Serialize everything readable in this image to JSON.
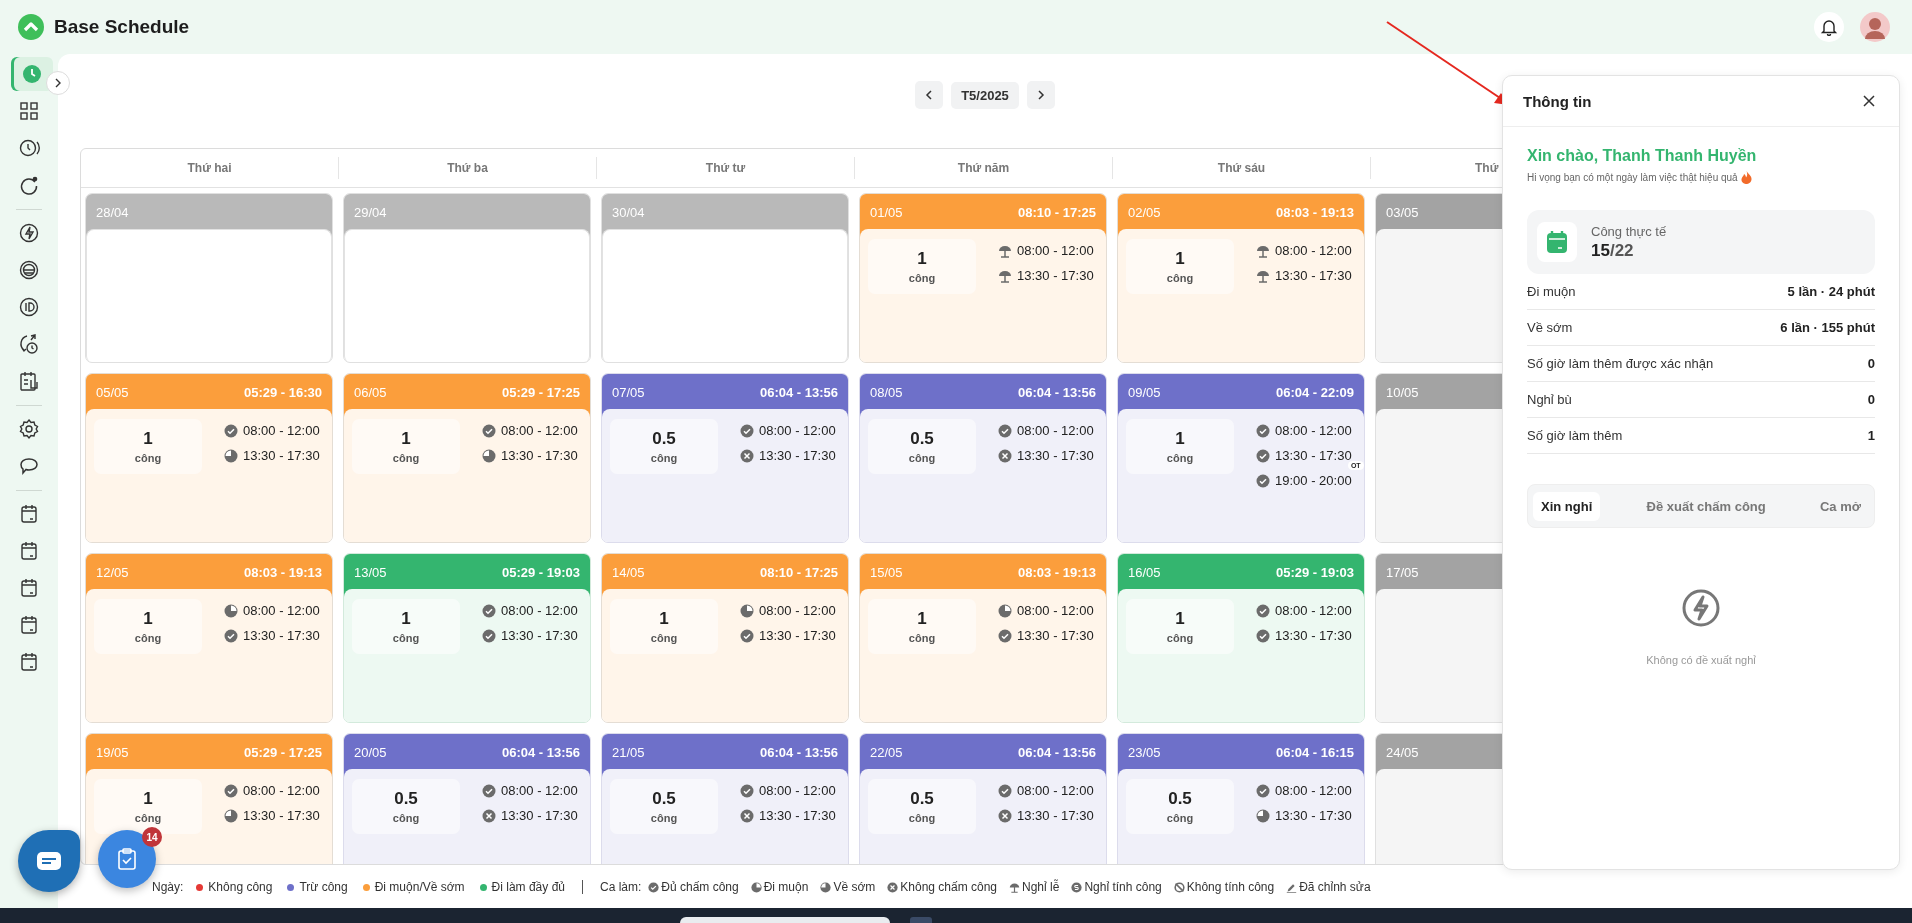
{
  "app": {
    "title": "Base Schedule"
  },
  "sidebar": {
    "groups": [
      [
        {
          "selected": true
        },
        {
          "selected": false
        },
        {
          "selected": false
        },
        {
          "selected": false
        }
      ],
      [
        {
          "selected": false
        },
        {
          "selected": false
        },
        {
          "selected": false
        },
        {
          "selected": false
        },
        {
          "selected": false
        }
      ],
      [
        {
          "selected": false
        },
        {
          "selected": false
        }
      ],
      [
        {
          "selected": false
        },
        {
          "selected": false
        },
        {
          "selected": false
        },
        {
          "selected": false
        },
        {
          "selected": false
        }
      ]
    ]
  },
  "month_nav": {
    "label": "T5/2025"
  },
  "calendar": {
    "days": [
      "Thứ hai",
      "Thứ ba",
      "Thứ tư",
      "Thứ năm",
      "Thứ sáu",
      "Thứ"
    ],
    "weeks": [
      [
        {
          "date": "28/04",
          "kind": "outside"
        },
        {
          "date": "29/04",
          "kind": "outside"
        },
        {
          "date": "30/04",
          "kind": "outside"
        },
        {
          "date": "01/05",
          "kind": "late_early",
          "hours": "08:10 - 17:25",
          "work": "1",
          "unit": "công",
          "shifts": [
            {
              "time": "08:00 - 12:00",
              "kind": "holiday"
            },
            {
              "time": "13:30 - 17:30",
              "kind": "holiday"
            }
          ]
        },
        {
          "date": "02/05",
          "kind": "late_early",
          "hours": "08:03 - 19:13",
          "work": "1",
          "unit": "công",
          "shifts": [
            {
              "time": "08:00 - 12:00",
              "kind": "holiday"
            },
            {
              "time": "13:30 - 17:30",
              "kind": "holiday"
            }
          ]
        },
        {
          "date": "03/05",
          "kind": "weekend"
        }
      ],
      [
        {
          "date": "05/05",
          "kind": "late_early",
          "hours": "05:29 - 16:30",
          "work": "1",
          "unit": "công",
          "shifts": [
            {
              "time": "08:00 - 12:00",
              "kind": "full"
            },
            {
              "time": "13:30 - 17:30",
              "kind": "early"
            }
          ]
        },
        {
          "date": "06/05",
          "kind": "late_early",
          "hours": "05:29 - 17:25",
          "work": "1",
          "unit": "công",
          "shifts": [
            {
              "time": "08:00 - 12:00",
              "kind": "full"
            },
            {
              "time": "13:30 - 17:30",
              "kind": "early"
            }
          ]
        },
        {
          "date": "07/05",
          "kind": "deducted",
          "hours": "06:04 - 13:56",
          "work": "0.5",
          "unit": "công",
          "shifts": [
            {
              "time": "08:00 - 12:00",
              "kind": "full"
            },
            {
              "time": "13:30 - 17:30",
              "kind": "missing"
            }
          ]
        },
        {
          "date": "08/05",
          "kind": "deducted",
          "hours": "06:04 - 13:56",
          "work": "0.5",
          "unit": "công",
          "shifts": [
            {
              "time": "08:00 - 12:00",
              "kind": "full"
            },
            {
              "time": "13:30 - 17:30",
              "kind": "missing"
            }
          ]
        },
        {
          "date": "09/05",
          "kind": "deducted",
          "hours": "06:04 - 22:09",
          "work": "1",
          "unit": "công",
          "shifts": [
            {
              "time": "08:00 - 12:00",
              "kind": "full"
            },
            {
              "time": "13:30 - 17:30",
              "kind": "full"
            },
            {
              "time": "19:00 - 20:00",
              "kind": "full",
              "badge": "OT"
            }
          ]
        },
        {
          "date": "10/05",
          "kind": "weekend"
        }
      ],
      [
        {
          "date": "12/05",
          "kind": "late_early",
          "hours": "08:03 - 19:13",
          "work": "1",
          "unit": "công",
          "shifts": [
            {
              "time": "08:00 - 12:00",
              "kind": "late"
            },
            {
              "time": "13:30 - 17:30",
              "kind": "full"
            }
          ]
        },
        {
          "date": "13/05",
          "kind": "full",
          "hours": "05:29 - 19:03",
          "work": "1",
          "unit": "công",
          "shifts": [
            {
              "time": "08:00 - 12:00",
              "kind": "full"
            },
            {
              "time": "13:30 - 17:30",
              "kind": "full"
            }
          ]
        },
        {
          "date": "14/05",
          "kind": "late_early",
          "hours": "08:10 - 17:25",
          "work": "1",
          "unit": "công",
          "shifts": [
            {
              "time": "08:00 - 12:00",
              "kind": "late"
            },
            {
              "time": "13:30 - 17:30",
              "kind": "full"
            }
          ]
        },
        {
          "date": "15/05",
          "kind": "late_early",
          "hours": "08:03 - 19:13",
          "work": "1",
          "unit": "công",
          "shifts": [
            {
              "time": "08:00 - 12:00",
              "kind": "late"
            },
            {
              "time": "13:30 - 17:30",
              "kind": "full"
            }
          ]
        },
        {
          "date": "16/05",
          "kind": "full",
          "hours": "05:29 - 19:03",
          "work": "1",
          "unit": "công",
          "shifts": [
            {
              "time": "08:00 - 12:00",
              "kind": "full"
            },
            {
              "time": "13:30 - 17:30",
              "kind": "full"
            }
          ]
        },
        {
          "date": "17/05",
          "kind": "weekend"
        }
      ],
      [
        {
          "date": "19/05",
          "kind": "late_early",
          "hours": "05:29 - 17:25",
          "work": "1",
          "unit": "công",
          "shifts": [
            {
              "time": "08:00 - 12:00",
              "kind": "full"
            },
            {
              "time": "13:30 - 17:30",
              "kind": "early"
            }
          ]
        },
        {
          "date": "20/05",
          "kind": "deducted",
          "hours": "06:04 - 13:56",
          "work": "0.5",
          "unit": "công",
          "shifts": [
            {
              "time": "08:00 - 12:00",
              "kind": "full"
            },
            {
              "time": "13:30 - 17:30",
              "kind": "missing"
            }
          ]
        },
        {
          "date": "21/05",
          "kind": "deducted",
          "hours": "06:04 - 13:56",
          "work": "0.5",
          "unit": "công",
          "shifts": [
            {
              "time": "08:00 - 12:00",
              "kind": "full"
            },
            {
              "time": "13:30 - 17:30",
              "kind": "missing"
            }
          ]
        },
        {
          "date": "22/05",
          "kind": "deducted",
          "hours": "06:04 - 13:56",
          "work": "0.5",
          "unit": "công",
          "shifts": [
            {
              "time": "08:00 - 12:00",
              "kind": "full"
            },
            {
              "time": "13:30 - 17:30",
              "kind": "missing"
            }
          ]
        },
        {
          "date": "23/05",
          "kind": "deducted",
          "hours": "06:04 - 16:15",
          "work": "0.5",
          "unit": "công",
          "shifts": [
            {
              "time": "08:00 - 12:00",
              "kind": "full"
            },
            {
              "time": "13:30 - 17:30",
              "kind": "early"
            }
          ]
        },
        {
          "date": "24/05",
          "kind": "weekend"
        }
      ]
    ]
  },
  "legend": {
    "day_label": "Ngày:",
    "day_items": [
      {
        "label": "Không công",
        "color": "#e53935"
      },
      {
        "label": "Trừ công",
        "color": "#6e70c9"
      },
      {
        "label": "Đi muộn/Về sớm",
        "color": "#fb9e3c"
      },
      {
        "label": "Đi làm đầy đủ",
        "color": "#34b56f"
      }
    ],
    "shift_label": "Ca làm:",
    "shift_items": [
      {
        "label": "Đủ chấm công",
        "kind": "full"
      },
      {
        "label": "Đi muộn",
        "kind": "late"
      },
      {
        "label": "Về sớm",
        "kind": "early"
      },
      {
        "label": "Không chấm công",
        "kind": "missing"
      },
      {
        "label": "Nghỉ lễ",
        "kind": "holiday"
      },
      {
        "label": "Nghỉ tính công",
        "kind": "paid"
      },
      {
        "label": "Không tính công",
        "kind": "unpaid"
      },
      {
        "label": "Đã chỉnh sửa",
        "kind": "edited"
      }
    ]
  },
  "task_button": {
    "badge": "14"
  },
  "panel": {
    "title": "Thông tin",
    "greeting": "Xin chào, Thanh Thanh Huyền",
    "subtitle": "Hi vọng bạn có một ngày làm việc thật hiệu quả",
    "stat": {
      "label": "Công thực tế",
      "value": "15",
      "total": "/22"
    },
    "rows": [
      {
        "label": "Đi muộn",
        "value": "5 lần · 24 phút"
      },
      {
        "label": "Về sớm",
        "value": "6 lần · 155 phút"
      },
      {
        "label": "Số giờ làm thêm được xác nhận",
        "value": "0"
      },
      {
        "label": "Nghỉ bù",
        "value": "0"
      },
      {
        "label": "Số giờ làm thêm",
        "value": "1"
      }
    ],
    "tabs": [
      {
        "label": "Xin nghỉ",
        "selected": true
      },
      {
        "label": "Đề xuất chấm công",
        "selected": false
      },
      {
        "label": "Ca mở",
        "selected": false
      }
    ],
    "empty": {
      "message": "Không có đề xuất nghỉ"
    }
  }
}
